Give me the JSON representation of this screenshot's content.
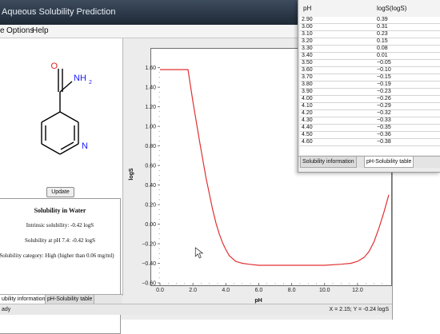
{
  "window": {
    "title": "Aqueous Solubility Prediction"
  },
  "menu": {
    "items": [
      {
        "label": "e"
      },
      {
        "label": "Options"
      },
      {
        "label": "Help"
      }
    ]
  },
  "molecule": {
    "labels": {
      "oxygen": "O",
      "amine": "NH",
      "amine_subscript": "2",
      "nitrogen": "N"
    },
    "colors": {
      "oxygen": "#e02020",
      "nitrogen": "#1a1aff",
      "bonds": "#000000"
    }
  },
  "update_button": "Update",
  "solubility_panel": {
    "title": "Solubility in Water",
    "intrinsic": "Intrinsic solubility: -0.42 logS",
    "at_ph": "Solubility at pH 7.4: -0.42 logS",
    "category": "Solubility category: High (higher than 0.06 mg/ml)"
  },
  "left_tabs": [
    {
      "label": "ubility information",
      "active": true
    },
    {
      "label": "pH-Solubility table",
      "active": false
    }
  ],
  "status": {
    "left": "ady",
    "coords": "X = 2.15; Y = -0.24 logS"
  },
  "table": {
    "headers": {
      "ph": "pH",
      "logs": "logS(logS)"
    },
    "rows": [
      {
        "ph": "2.90",
        "logs": "0.39"
      },
      {
        "ph": "3.00",
        "logs": "0.31"
      },
      {
        "ph": "3.10",
        "logs": "0.23"
      },
      {
        "ph": "3.20",
        "logs": "0.15"
      },
      {
        "ph": "3.30",
        "logs": "0.08"
      },
      {
        "ph": "3.40",
        "logs": "0.01"
      },
      {
        "ph": "3.50",
        "logs": "−0.05"
      },
      {
        "ph": "3.60",
        "logs": "−0.10"
      },
      {
        "ph": "3.70",
        "logs": "−0.15"
      },
      {
        "ph": "3.80",
        "logs": "−0.19"
      },
      {
        "ph": "3.90",
        "logs": "−0.23"
      },
      {
        "ph": "4.00",
        "logs": "−0.26"
      },
      {
        "ph": "4.10",
        "logs": "−0.29"
      },
      {
        "ph": "4.20",
        "logs": "−0.32"
      },
      {
        "ph": "4.30",
        "logs": "−0.33"
      },
      {
        "ph": "4.40",
        "logs": "−0.35"
      },
      {
        "ph": "4.50",
        "logs": "−0.36"
      },
      {
        "ph": "4.60",
        "logs": "−0.38"
      }
    ],
    "tabs": [
      {
        "label": "Solubility information",
        "active": false
      },
      {
        "label": "pH-Solubility table",
        "active": true
      }
    ]
  },
  "chart_data": {
    "type": "line",
    "xlabel": "pH",
    "ylabel": "logS",
    "xlim": [
      0.0,
      13.9
    ],
    "ylim": [
      -0.6,
      1.72
    ],
    "x_ticks": [
      "0.0",
      "2.0",
      "4.0",
      "6.0",
      "8.0",
      "10.0",
      "12.0"
    ],
    "x_tick_values": [
      0,
      2,
      4,
      6,
      8,
      10,
      12
    ],
    "y_ticks": [
      "1.60",
      "1.40",
      "1.20",
      "1.00",
      "0.80",
      "0.60",
      "0.40",
      "0.20",
      "0.00",
      "−0.20",
      "−0.40",
      "−0.60"
    ],
    "y_tick_values": [
      1.6,
      1.4,
      1.2,
      1.0,
      0.8,
      0.6,
      0.4,
      0.2,
      0.0,
      -0.2,
      -0.4,
      -0.6
    ],
    "grid": false,
    "series_color": "#e23030",
    "series": [
      {
        "x": [
          0.0,
          1.7,
          2.0,
          2.2,
          2.4,
          2.6,
          2.8,
          3.0,
          3.2,
          3.4,
          3.6,
          3.8,
          4.0,
          4.2,
          4.4,
          4.6,
          4.8,
          5.0,
          5.4,
          6.0,
          8.0,
          10.0,
          11.0,
          11.6,
          12.0,
          12.4,
          12.7,
          13.0,
          13.3,
          13.6,
          13.9
        ],
        "y": [
          1.58,
          1.58,
          1.25,
          1.05,
          0.85,
          0.66,
          0.47,
          0.31,
          0.15,
          0.01,
          -0.1,
          -0.19,
          -0.26,
          -0.32,
          -0.35,
          -0.38,
          -0.39,
          -0.4,
          -0.41,
          -0.42,
          -0.42,
          -0.42,
          -0.41,
          -0.4,
          -0.38,
          -0.34,
          -0.28,
          -0.18,
          -0.04,
          0.12,
          0.3
        ]
      }
    ]
  }
}
